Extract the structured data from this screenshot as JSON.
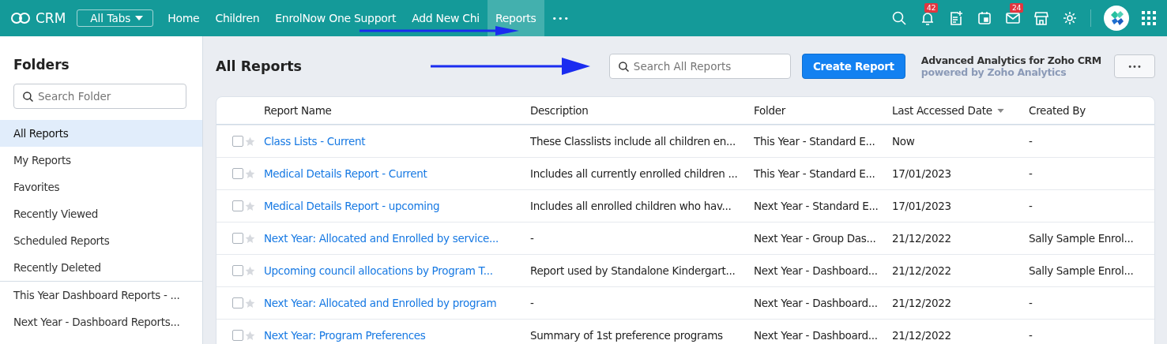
{
  "top_bar": {
    "app_name": "CRM",
    "all_tabs": "All Tabs",
    "tabs": [
      {
        "label": "Home",
        "selected": false
      },
      {
        "label": "Children",
        "selected": false
      },
      {
        "label": "EnrolNow One Support",
        "selected": false
      },
      {
        "label": "Add New Chi",
        "selected": false
      },
      {
        "label": "Reports",
        "selected": true
      }
    ],
    "more": "•••",
    "notifications_badge": "42",
    "mail_badge": "24"
  },
  "sidebar": {
    "title": "Folders",
    "search": {
      "placeholder": "Search Folder"
    },
    "items": [
      {
        "label": "All Reports",
        "selected": true
      },
      {
        "label": "My Reports",
        "selected": false
      },
      {
        "label": "Favorites",
        "selected": false
      },
      {
        "label": "Recently Viewed",
        "selected": false
      },
      {
        "label": "Scheduled Reports",
        "selected": false
      },
      {
        "label": "Recently Deleted",
        "selected": false
      }
    ],
    "folders": [
      {
        "label": "This Year Dashboard Reports - ...",
        "selected": false
      },
      {
        "label": "Next Year - Dashboard Reports...",
        "selected": false
      }
    ]
  },
  "main": {
    "title": "All Reports",
    "search": {
      "placeholder": "Search All Reports"
    },
    "create_button": "Create Report",
    "promo_title": "Advanced Analytics for Zoho CRM",
    "promo_subtitle": "powered by Zoho Analytics",
    "more_button": "•••",
    "table": {
      "columns": [
        "Report Name",
        "Description",
        "Folder",
        "Last Accessed Date",
        "Created By"
      ],
      "rows": [
        {
          "name": "Class Lists - Current",
          "description": "These Classlists include all children en...",
          "folder": "This Year - Standard E...",
          "last_accessed": "Now",
          "created_by": "-",
          "checked": false,
          "starred": false
        },
        {
          "name": "Medical Details Report - Current",
          "description": "Includes all currently enrolled children ...",
          "folder": "This Year - Standard E...",
          "last_accessed": "17/01/2023",
          "created_by": "-",
          "checked": false,
          "starred": false
        },
        {
          "name": "Medical Details Report - upcoming",
          "description": "Includes all enrolled children who hav...",
          "folder": "Next Year - Standard E...",
          "last_accessed": "17/01/2023",
          "created_by": "-",
          "checked": false,
          "starred": false
        },
        {
          "name": "Next Year: Allocated and Enrolled by service...",
          "description": "-",
          "folder": "Next Year - Group Das...",
          "last_accessed": "21/12/2022",
          "created_by": "Sally Sample Enrol...",
          "checked": false,
          "starred": false
        },
        {
          "name": "Upcoming council allocations by Program T...",
          "description": "Report used by Standalone Kindergart...",
          "folder": "Next Year - Dashboard...",
          "last_accessed": "21/12/2022",
          "created_by": "Sally Sample Enrol...",
          "checked": false,
          "starred": false
        },
        {
          "name": "Next Year: Allocated and Enrolled by program",
          "description": "-",
          "folder": "Next Year - Dashboard...",
          "last_accessed": "21/12/2022",
          "created_by": "-",
          "checked": false,
          "starred": false
        },
        {
          "name": "Next Year: Program Preferences",
          "description": "Summary of 1st preference programs",
          "folder": "Next Year - Dashboard...",
          "last_accessed": "21/12/2022",
          "created_by": "-",
          "checked": false,
          "starred": false
        }
      ]
    }
  }
}
